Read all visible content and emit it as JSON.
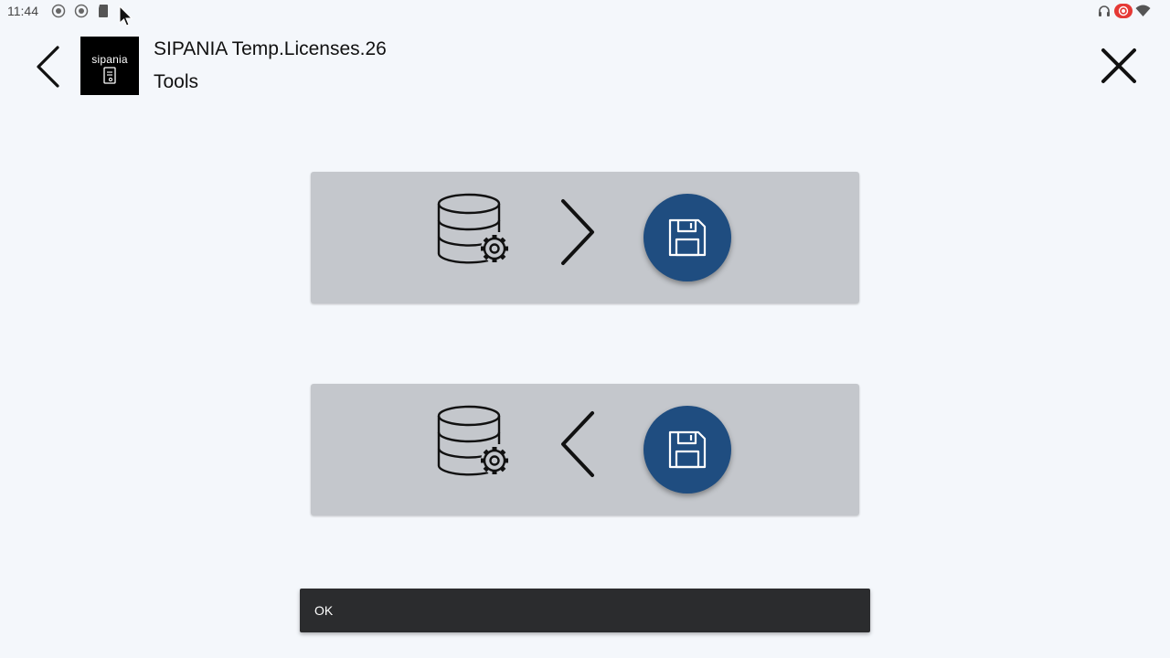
{
  "status_bar": {
    "time": "11:44"
  },
  "header": {
    "logo_text": "sipania",
    "title": "SIPANIA Temp.Licenses.26",
    "subtitle": "Tools"
  },
  "cards": [
    {
      "name": "export-to-file",
      "db_icon": "database-gear-icon",
      "arrow_icon": "chevron-right-icon",
      "file_icon": "floppy-disk-icon"
    },
    {
      "name": "import-from-file",
      "db_icon": "database-gear-icon",
      "arrow_icon": "chevron-left-icon",
      "file_icon": "floppy-disk-icon"
    }
  ],
  "snackbar": {
    "message": "OK"
  },
  "colors": {
    "background": "#f4f7fb",
    "card": "#c4c7cc",
    "save_circle": "#1f4d80",
    "snackbar": "#2b2c2e",
    "record_indicator": "#e53935"
  }
}
